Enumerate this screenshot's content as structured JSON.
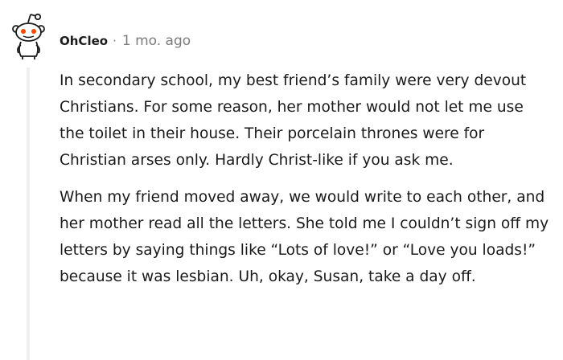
{
  "comment": {
    "username": "OhCleo",
    "separator": "·",
    "timestamp": "1 mo. ago",
    "avatar_icon": "snoo-avatar-icon",
    "paragraphs": [
      "In secondary school, my best friend’s family were very devout Christians. For some reason, her mother would not let me use the toilet in their house. Their porcelain thrones were for Christian arses only. Hardly Christ-like if you ask me.",
      "When my friend moved away, we would write to each other, and her mother read all the letters. She told me I couldn’t sign off my letters by saying things like “Lots of love!” or “Love you loads!” because it was lesbian. Uh, okay, Susan, take a day off."
    ]
  },
  "colors": {
    "text": "#1a1a1b",
    "meta": "#7c7c7c",
    "thread_line": "#edeff1",
    "avatar_eye": "#ff4500"
  }
}
